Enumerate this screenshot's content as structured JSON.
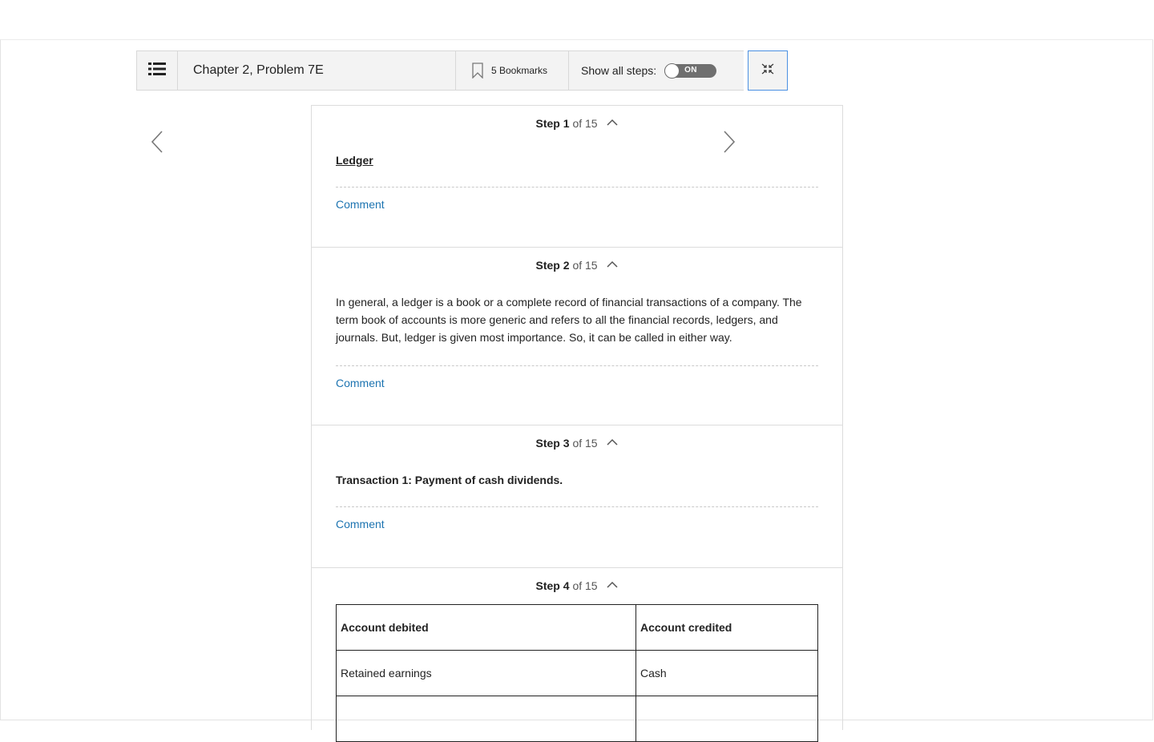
{
  "toolbar": {
    "title": "Chapter 2, Problem 7E",
    "bookmarks_label": "5 Bookmarks",
    "show_all_steps_label": "Show all steps:",
    "toggle_label": "ON"
  },
  "steps": [
    {
      "word": "Step",
      "number": "1",
      "of_label": "of 15",
      "heading": "Ledger",
      "comment_label": "Comment"
    },
    {
      "word": "Step",
      "number": "2",
      "of_label": "of 15",
      "text": "In general, a ledger is a book or a complete record of financial transactions of a company. The term book of accounts is more generic and refers to all the financial records, ledgers, and journals. But, ledger is given most importance. So, it can be called in either way.",
      "comment_label": "Comment"
    },
    {
      "word": "Step",
      "number": "3",
      "of_label": "of 15",
      "text": "Transaction 1: Payment of cash dividends.",
      "comment_label": "Comment"
    },
    {
      "word": "Step",
      "number": "4",
      "of_label": "of 15",
      "table": {
        "headers": [
          "Account debited",
          "Account credited"
        ],
        "rows": [
          [
            "Retained earnings",
            "Cash"
          ],
          [
            "",
            ""
          ]
        ]
      }
    }
  ],
  "icons": {
    "menu": "list-icon",
    "bookmark": "bookmark-icon",
    "collapse": "collapse-icon",
    "prev": "chevron-left-icon",
    "next": "chevron-right-icon",
    "step_toggle": "chevron-up-icon"
  },
  "colors": {
    "link": "#1d74b1",
    "toggle": "#6f6f6f",
    "focus_border": "#4b90e2"
  }
}
